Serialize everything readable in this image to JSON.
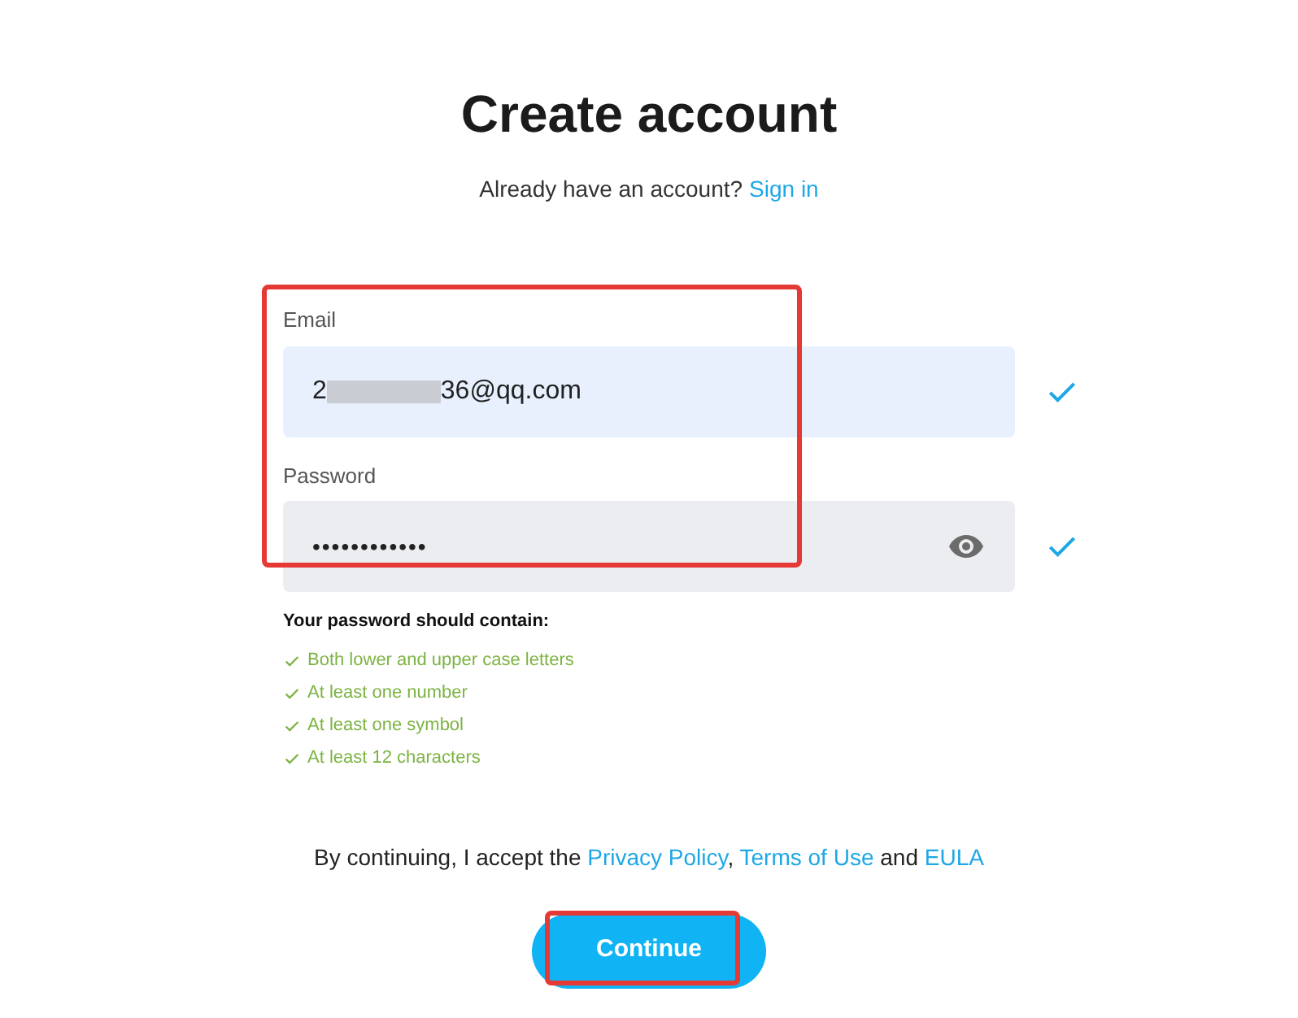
{
  "title": "Create account",
  "signin": {
    "prompt": "Already have an account?",
    "link": "Sign in"
  },
  "fields": [
    {
      "kind": "email",
      "label": "Email",
      "value_start": "2",
      "value_end": "36@qq.com",
      "redacted": true,
      "valid": true
    },
    {
      "kind": "password",
      "label": "Password",
      "value": "••••••••••••",
      "valid": true
    }
  ],
  "form": {
    "highlighted": true
  },
  "rules": {
    "heading": "Your password should contain:",
    "items": [
      {
        "text": "Both lower and upper case letters",
        "met": true
      },
      {
        "text": "At least one number",
        "met": true
      },
      {
        "text": "At least one symbol",
        "met": true
      },
      {
        "text": "At least 12 characters",
        "met": true
      }
    ]
  },
  "consent": {
    "text": "By continuing, I accept the",
    "links": [
      "Privacy Policy",
      "Terms of Use",
      "EULA"
    ],
    "separator": ",",
    "conjunction": "and"
  },
  "button": {
    "label": "Continue",
    "highlighted": true
  }
}
